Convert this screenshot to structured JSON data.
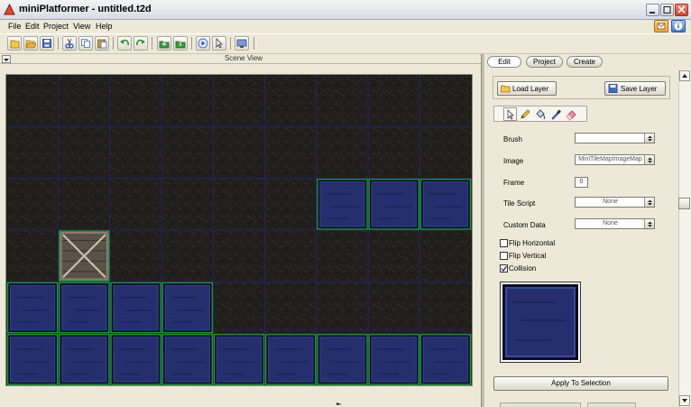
{
  "window": {
    "title": "miniPlatformer - untitled.t2d",
    "icon": "app-icon"
  },
  "menu": [
    "File",
    "Edit",
    "Project",
    "View",
    "Help"
  ],
  "toolbar": {
    "buttons": [
      "new-icon",
      "open-icon",
      "save-icon",
      "cut-icon",
      "copy-icon",
      "paste-icon",
      "undo-icon",
      "redo-icon",
      "import-icon",
      "export-icon",
      "play-icon",
      "select-icon",
      "screen-icon"
    ]
  },
  "scene": {
    "title": "Scene View",
    "grid": {
      "columns": 9,
      "rows": 6
    },
    "tiles": [
      {
        "col": 6,
        "row": 2,
        "kind": "blue-block"
      },
      {
        "col": 7,
        "row": 2,
        "kind": "blue-block"
      },
      {
        "col": 8,
        "row": 2,
        "kind": "blue-block"
      },
      {
        "col": 1,
        "row": 3,
        "kind": "crate"
      },
      {
        "col": 0,
        "row": 4,
        "kind": "blue-block"
      },
      {
        "col": 1,
        "row": 4,
        "kind": "blue-block"
      },
      {
        "col": 2,
        "row": 4,
        "kind": "blue-block"
      },
      {
        "col": 3,
        "row": 4,
        "kind": "blue-block"
      },
      {
        "col": 0,
        "row": 5,
        "kind": "blue-block"
      },
      {
        "col": 1,
        "row": 5,
        "kind": "blue-block"
      },
      {
        "col": 2,
        "row": 5,
        "kind": "blue-block"
      },
      {
        "col": 3,
        "row": 5,
        "kind": "blue-block"
      },
      {
        "col": 4,
        "row": 5,
        "kind": "blue-block"
      },
      {
        "col": 5,
        "row": 5,
        "kind": "blue-block"
      },
      {
        "col": 6,
        "row": 5,
        "kind": "blue-block"
      },
      {
        "col": 7,
        "row": 5,
        "kind": "blue-block"
      },
      {
        "col": 8,
        "row": 5,
        "kind": "blue-block"
      }
    ]
  },
  "panel": {
    "tabs": [
      "Edit",
      "Project",
      "Create"
    ],
    "active_tab": "Edit",
    "load_layer": "Load Layer",
    "save_layer": "Save Layer",
    "tools": [
      "pointer-icon",
      "pencil-icon",
      "bucket-icon",
      "eyedropper-icon",
      "eraser-icon"
    ],
    "fields": {
      "brush": {
        "label": "Brush",
        "value": ""
      },
      "image": {
        "label": "Image",
        "value": "MiniTileMapImageMap"
      },
      "frame": {
        "label": "Frame",
        "value": "0"
      },
      "tile_script": {
        "label": "Tile Script",
        "value": "None"
      },
      "custom_data": {
        "label": "Custom Data",
        "value": "None"
      }
    },
    "checks": {
      "flip_horizontal": {
        "label": "Flip Horizontal",
        "checked": false
      },
      "flip_vertical": {
        "label": "Flip Vertical",
        "checked": false
      },
      "collision": {
        "label": "Collision",
        "checked": true
      }
    },
    "apply": "Apply To Selection"
  },
  "colors": {
    "tile_blue": "#262f6e",
    "tile_border": "#1e9b2e",
    "grid_line": "#23237a",
    "accent": "#316ac5"
  }
}
